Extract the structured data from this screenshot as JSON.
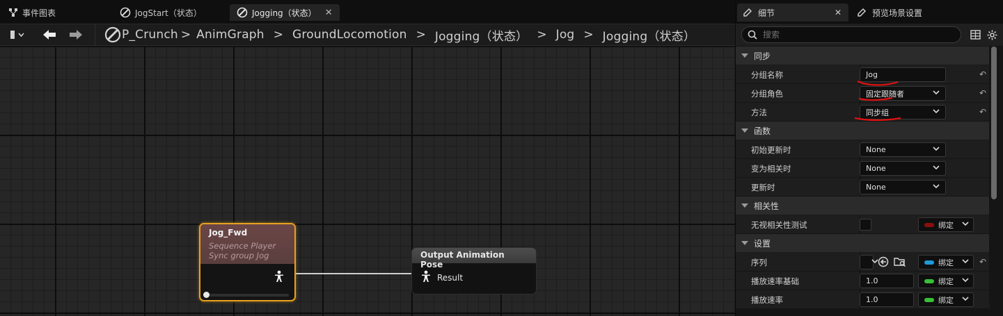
{
  "tabs": [
    {
      "label": "事件图表",
      "icon": "event-graph-icon",
      "active": false
    },
    {
      "label": "JogStart（状态）",
      "icon": "state-icon",
      "active": false
    },
    {
      "label": "Jogging（状态）",
      "icon": "state-icon",
      "active": true
    }
  ],
  "breadcrumb": {
    "items": [
      "P_Crunch",
      "AnimGraph",
      "GroundLocomotion",
      "Jogging（状态）",
      "Jog",
      "Jogging（状态）"
    ],
    "separator": ">"
  },
  "graph": {
    "sequence_node": {
      "title": "Jog_Fwd",
      "subtitle": "Sequence Player",
      "sync": "Sync group Jog",
      "accent": "#e8a020"
    },
    "output_node": {
      "title": "Output Animation Pose",
      "pin_label": "Result"
    }
  },
  "panel": {
    "tabs": [
      {
        "label": "细节",
        "active": true
      },
      {
        "label": "预览场景设置",
        "active": false
      }
    ],
    "search_placeholder": "搜索",
    "categories": {
      "sync": "同步",
      "functions": "函数",
      "relevancy": "相关性",
      "settings": "设置"
    },
    "rows": {
      "group_name": {
        "label": "分组名称",
        "value": "Jog"
      },
      "group_role": {
        "label": "分组角色",
        "value": "固定跟随者"
      },
      "method": {
        "label": "方法",
        "value": "同步组"
      },
      "initial_update": {
        "label": "初始更新时",
        "value": "None"
      },
      "became_relevant": {
        "label": "变为相关时",
        "value": "None"
      },
      "on_update": {
        "label": "更新时",
        "value": "None"
      },
      "ignore_relevancy": {
        "label": "无视相关性测试",
        "bind": "绑定",
        "bind_color": "#8b0e0e"
      },
      "sequence": {
        "label": "序列",
        "bind": "绑定",
        "bind_color": "#1e9ad8"
      },
      "play_rate_basis": {
        "label": "播放速率基础",
        "value": "1.0",
        "bind": "绑定",
        "bind_color": "#38c038"
      },
      "play_rate": {
        "label": "播放速率",
        "value": "1.0",
        "bind": "绑定",
        "bind_color": "#38c038"
      }
    }
  }
}
